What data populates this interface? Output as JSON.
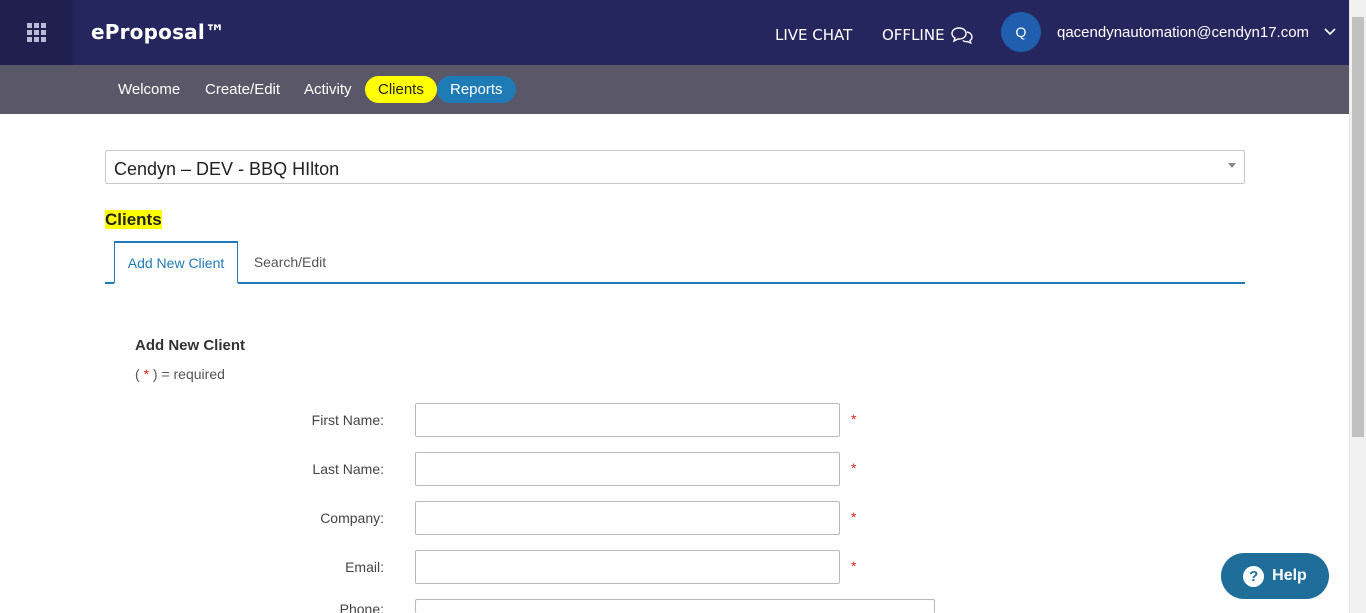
{
  "header": {
    "brand": "eProposal™",
    "live_chat": "LIVE CHAT",
    "offline": "OFFLINE",
    "avatar_initial": "Q",
    "user_email": "qacendynautomation@cendyn17.com"
  },
  "nav": {
    "items": [
      "Welcome",
      "Create/Edit",
      "Activity",
      "Clients",
      "Reports"
    ],
    "active": "Clients"
  },
  "property_select": {
    "value": "Cendyn – DEV - BBQ HIlton"
  },
  "page": {
    "section_title": "Clients",
    "tabs": [
      "Add New Client",
      "Search/Edit"
    ],
    "active_tab": "Add New Client"
  },
  "form": {
    "title": "Add New Client",
    "required_note_open": "( ",
    "required_star": "*",
    "required_note_close": " ) = required",
    "fields": [
      {
        "label": "First Name:",
        "value": "",
        "required": true
      },
      {
        "label": "Last Name:",
        "value": "",
        "required": true
      },
      {
        "label": "Company:",
        "value": "",
        "required": true
      },
      {
        "label": "Email:",
        "value": "",
        "required": true
      },
      {
        "label": "Phone:",
        "value": "",
        "required": false
      }
    ]
  },
  "help_button": {
    "label": "Help",
    "icon": "question-icon"
  },
  "colors": {
    "header_bg": "#26265e",
    "subnav_bg": "#5a5868",
    "active_highlight": "#ffff00",
    "accent_blue": "#1f7bb5",
    "required_red": "#d22"
  }
}
